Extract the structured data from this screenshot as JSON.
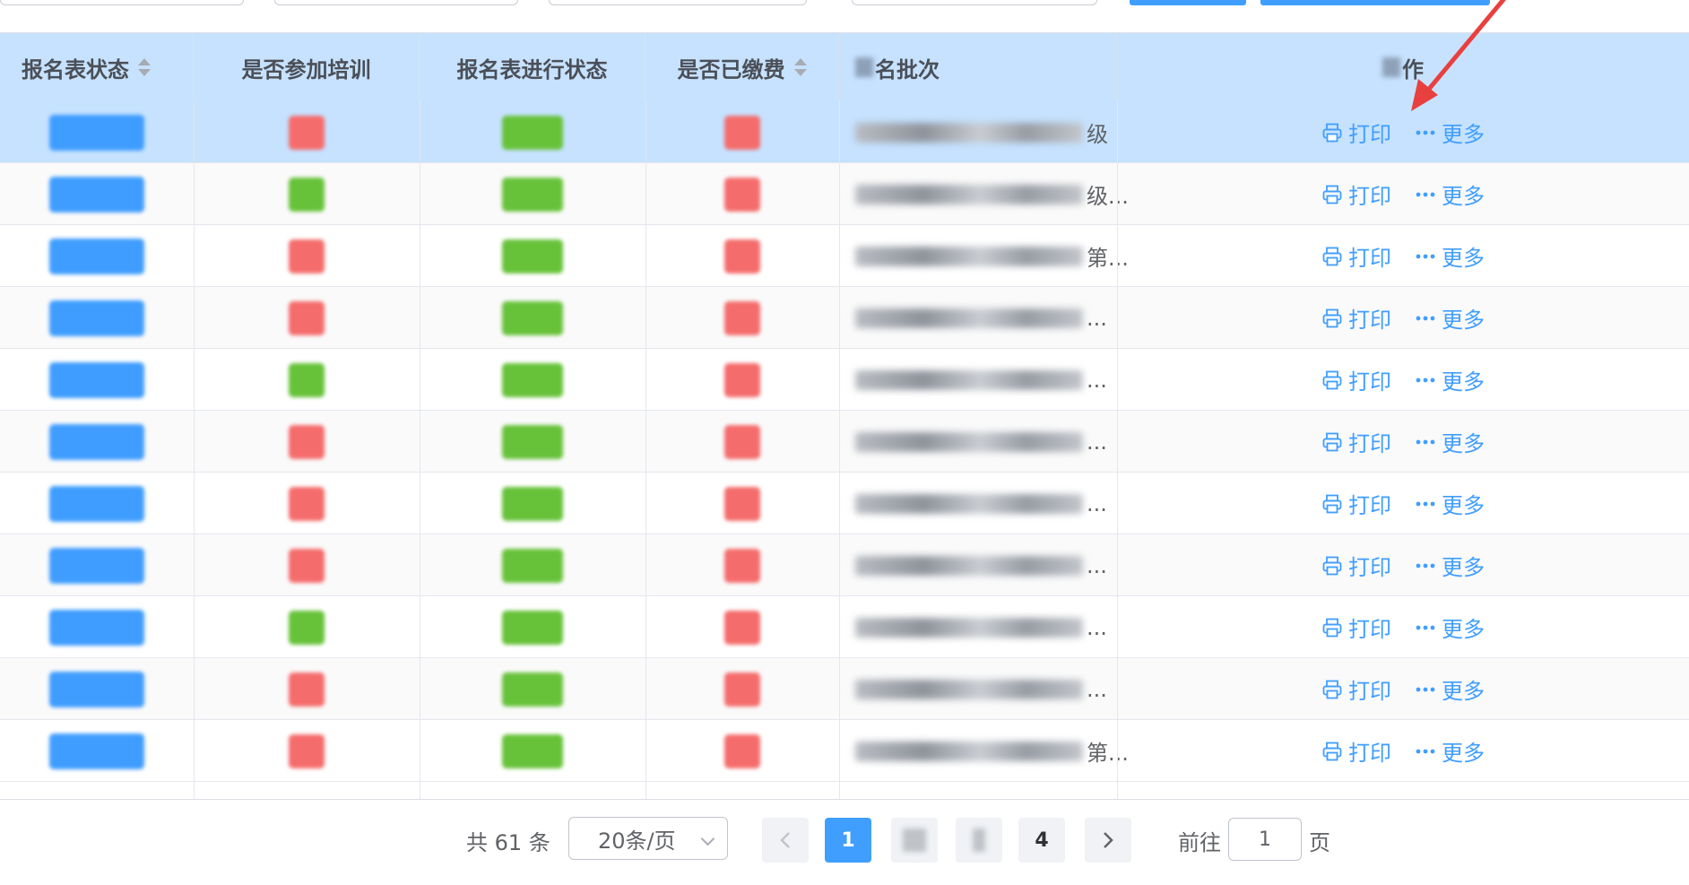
{
  "table": {
    "columns": [
      {
        "key": "status",
        "label": "报名表状态",
        "sortable": true
      },
      {
        "key": "training",
        "label": "是否参加培训",
        "sortable": false
      },
      {
        "key": "progress",
        "label": "报名表进行状态",
        "sortable": false
      },
      {
        "key": "paid",
        "label": "是否已缴费",
        "sortable": true
      },
      {
        "key": "batch",
        "label": "名批次",
        "sortable": false
      },
      {
        "key": "ops",
        "label": "作",
        "sortable": false
      }
    ],
    "rows": [
      {
        "training": "red",
        "batch_suffix": "级",
        "selected": true
      },
      {
        "training": "green",
        "batch_suffix": "级..."
      },
      {
        "training": "red",
        "batch_suffix": "第..."
      },
      {
        "training": "red",
        "batch_suffix": "..."
      },
      {
        "training": "green",
        "batch_suffix": "..."
      },
      {
        "training": "red",
        "batch_suffix": "..."
      },
      {
        "training": "red",
        "batch_suffix": "..."
      },
      {
        "training": "red",
        "batch_suffix": "..."
      },
      {
        "training": "green",
        "batch_suffix": "..."
      },
      {
        "training": "red",
        "batch_suffix": "..."
      },
      {
        "training": "red",
        "batch_suffix": "第..."
      }
    ],
    "actions": {
      "print_label": "打印",
      "more_label": "更多",
      "print_icon": "printer-icon",
      "more_icon": "ellipsis-icon"
    }
  },
  "pagination": {
    "total_text": "共 61 条",
    "page_size": "20条/页",
    "current_page": "1",
    "last_page": "4",
    "prev_icon": "chevron-left-icon",
    "next_icon": "chevron-right-icon",
    "goto_label": "前往",
    "goto_value": "1",
    "page_suffix": "页"
  },
  "colors": {
    "header_bg": "#c6e2ff",
    "selected_row_bg": "#c6e2ff",
    "accent": "#409eff",
    "status_blue": "#3f9dff",
    "tag_red": "#f56c6c",
    "tag_green": "#67c23a",
    "annotation_arrow": "#e8403f"
  }
}
